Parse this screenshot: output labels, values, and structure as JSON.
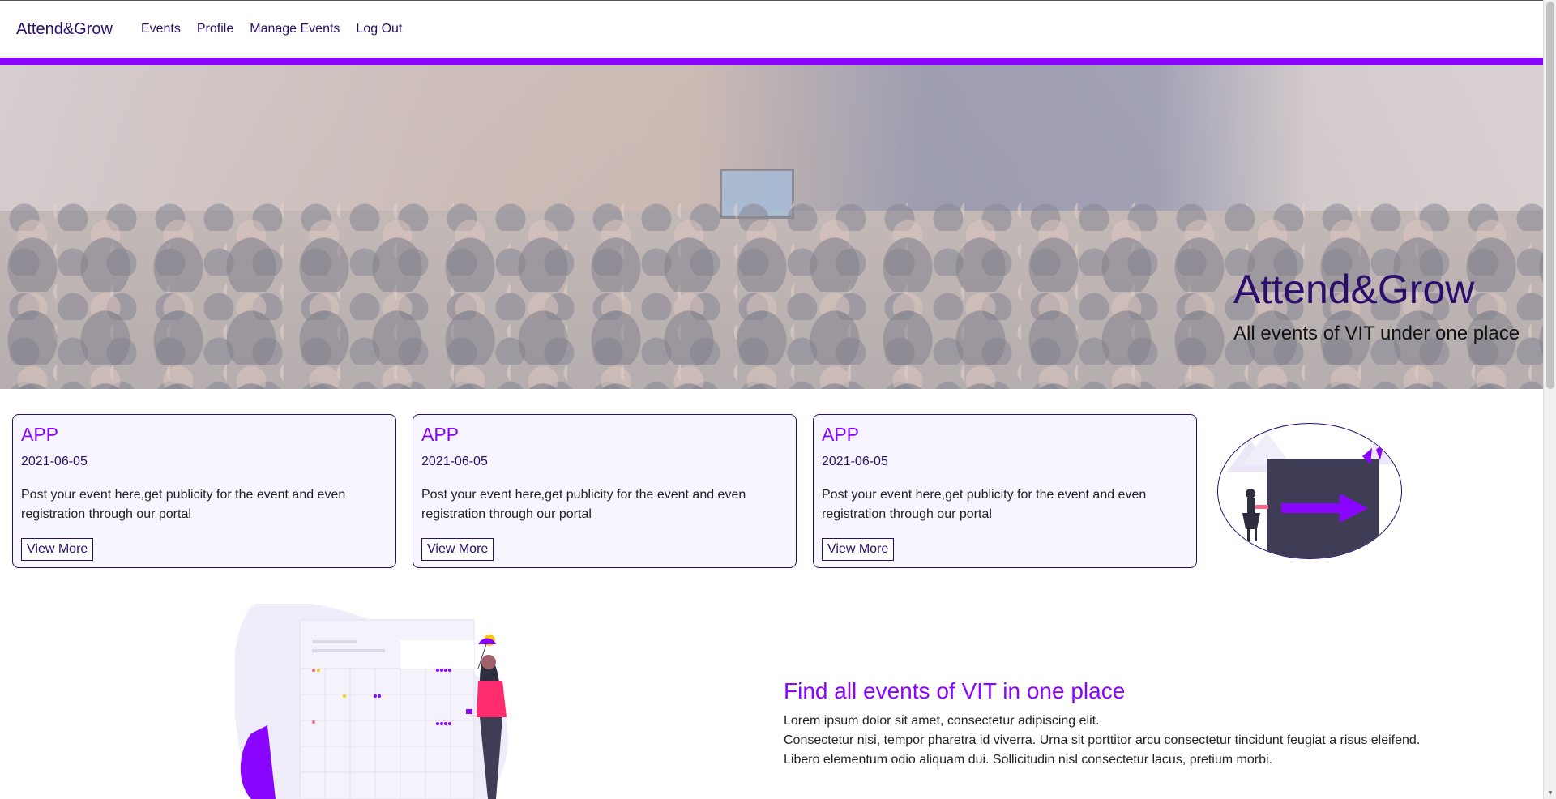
{
  "navbar": {
    "brand": "Attend&Grow",
    "links": [
      "Events",
      "Profile",
      "Manage Events",
      "Log Out"
    ]
  },
  "hero": {
    "title": "Attend&Grow",
    "subtitle": "All events of VIT under one place"
  },
  "cards": [
    {
      "title": "APP",
      "date": "2021-06-05",
      "description": "Post your event here,get publicity for the event and even registration through our portal",
      "button": "View More"
    },
    {
      "title": "APP",
      "date": "2021-06-05",
      "description": "Post your event here,get publicity for the event and even registration through our portal",
      "button": "View More"
    },
    {
      "title": "APP",
      "date": "2021-06-05",
      "description": "Post your event here,get publicity for the event and even registration through our portal",
      "button": "View More"
    }
  ],
  "feature": {
    "title": "Find all events of VIT in one place",
    "lines": [
      "Lorem ipsum dolor sit amet, consectetur adipiscing elit.",
      "Consectetur nisi, tempor pharetra id viverra. Urna sit porttitor arcu consectetur tincidunt feugiat a risus eleifend.",
      "Libero elementum odio aliquam dui. Sollicitudin nisl consectetur lacus, pretium morbi."
    ]
  },
  "colors": {
    "accent": "#8a05ff",
    "brand_dark": "#2b0e6b",
    "card_bg": "#f7f5ff"
  },
  "icons": {
    "oval_illustration": "door-exit-illustration",
    "calendar_illustration": "calendar-woman-illustration",
    "hero_image": "conference-audience-photo"
  }
}
